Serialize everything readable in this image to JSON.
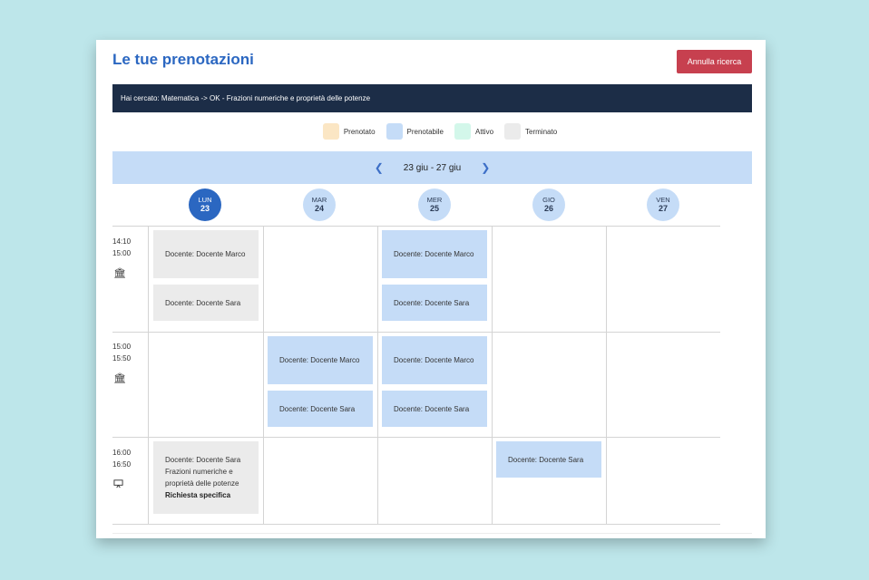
{
  "header": {
    "title": "Le tue prenotazioni",
    "cancel_label": "Annulla ricerca"
  },
  "search": {
    "text": "Hai cercato: Matematica -> OK - Frazioni numeriche e proprietà delle potenze"
  },
  "legend": [
    {
      "label": "Prenotato",
      "color": "#fbe6c4"
    },
    {
      "label": "Prenotabile",
      "color": "#c5dcf7"
    },
    {
      "label": "Attivo",
      "color": "#d3f7ea"
    },
    {
      "label": "Terminato",
      "color": "#ebebeb"
    }
  ],
  "week": {
    "range": "23 giu - 27 giu",
    "prev_icon": "chevron-left-icon",
    "next_icon": "chevron-right-icon"
  },
  "days": [
    {
      "name": "LUN",
      "num": "23",
      "active": true
    },
    {
      "name": "MAR",
      "num": "24",
      "active": false
    },
    {
      "name": "MER",
      "num": "25",
      "active": false
    },
    {
      "name": "GIO",
      "num": "26",
      "active": false
    },
    {
      "name": "VEN",
      "num": "27",
      "active": false
    }
  ],
  "time_slots": [
    {
      "start": "14:10",
      "end": "15:00",
      "icon": "building-icon"
    },
    {
      "start": "15:00",
      "end": "15:50",
      "icon": "building-icon"
    },
    {
      "start": "16:00",
      "end": "16:50",
      "icon": "presentation-icon"
    }
  ],
  "slots": {
    "r1_lun_a": "Docente: Docente Marco",
    "r1_lun_b": "Docente: Docente Sara",
    "r1_mer_a": "Docente: Docente Marco",
    "r1_mer_b": "Docente: Docente Sara",
    "r2_mar_a": "Docente: Docente Marco",
    "r2_mar_b": "Docente: Docente Sara",
    "r2_mer_a": "Docente: Docente Marco",
    "r2_mer_b": "Docente: Docente Sara",
    "r3_lun_line1": "Docente: Docente Sara",
    "r3_lun_line2": "Frazioni numeriche e proprietà delle potenze",
    "r3_lun_line3": "Richiesta specifica",
    "r3_gio_a": "Docente: Docente Sara"
  }
}
